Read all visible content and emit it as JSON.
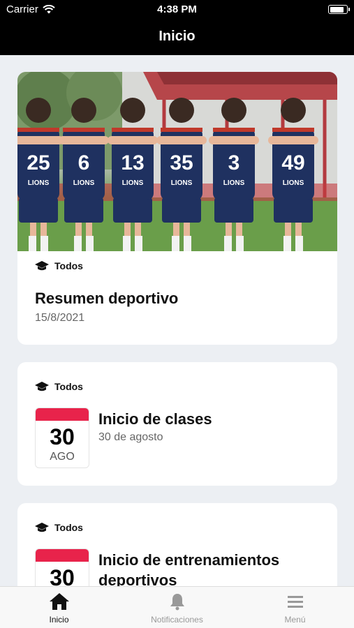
{
  "status_bar": {
    "carrier": "Carrier",
    "time": "4:38 PM",
    "battery_level": 0.9
  },
  "nav": {
    "title": "Inicio"
  },
  "feed": [
    {
      "audience": "Todos",
      "title": "Resumen deportivo",
      "date": "15/8/2021",
      "image": "team-photo"
    },
    {
      "audience": "Todos",
      "title": "Inicio de clases",
      "subtitle": "30 de agosto",
      "day": "30",
      "month": "AGO"
    },
    {
      "audience": "Todos",
      "title": "Inicio de entrenamientos deportivos",
      "day": "30"
    }
  ],
  "photo_jerseys": [
    "25",
    "6",
    "13",
    "35",
    "3",
    "49"
  ],
  "photo_jersey_text": "LIONS",
  "tabs": [
    {
      "label": "Inicio",
      "icon": "home-icon",
      "active": true
    },
    {
      "label": "Notificaciones",
      "icon": "bell-icon",
      "active": false
    },
    {
      "label": "Menú",
      "icon": "menu-icon",
      "active": false
    }
  ],
  "colors": {
    "bar": "#000000",
    "accent": "#e8234b",
    "background": "#eceff3",
    "jersey": "#1f3160"
  }
}
